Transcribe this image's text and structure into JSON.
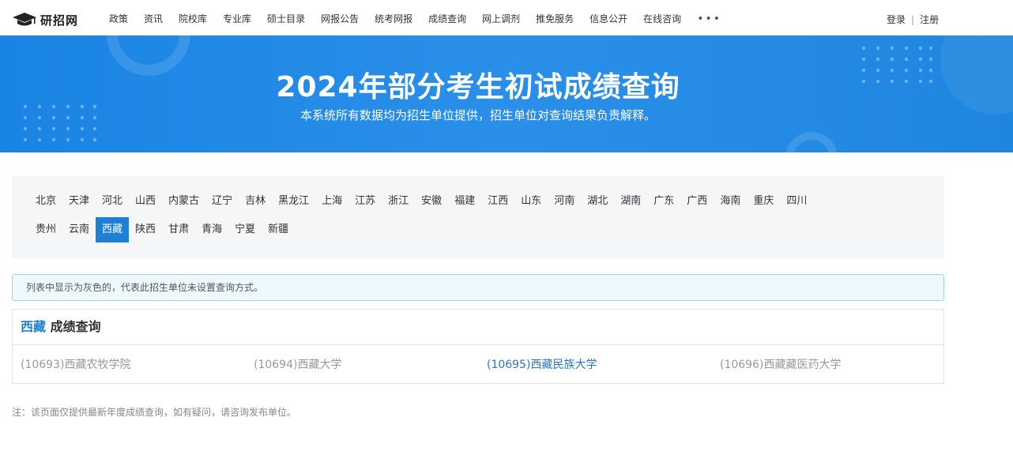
{
  "header": {
    "logo_text": "研招网",
    "nav": [
      "政策",
      "资讯",
      "院校库",
      "专业库",
      "硕士目录",
      "网报公告",
      "统考网报",
      "成绩查询",
      "网上调剂",
      "推免服务",
      "信息公开",
      "在线咨询"
    ],
    "more": "•••",
    "login": "登录",
    "separator": "|",
    "register": "注册"
  },
  "banner": {
    "title": "2024年部分考生初试成绩查询",
    "subtitle": "本系统所有数据均为招生单位提供，招生单位对查询结果负责解释。"
  },
  "provinces": {
    "row1": [
      "北京",
      "天津",
      "河北",
      "山西",
      "内蒙古",
      "辽宁",
      "吉林",
      "黑龙江",
      "上海",
      "江苏",
      "浙江",
      "安徽",
      "福建",
      "江西",
      "山东",
      "河南",
      "湖北",
      "湖南",
      "广东",
      "广西",
      "海南",
      "重庆",
      "四川"
    ],
    "row2": [
      "贵州",
      "云南",
      "西藏",
      "陕西",
      "甘肃",
      "青海",
      "宁夏",
      "新疆"
    ],
    "selected": "西藏"
  },
  "info_text": "列表中显示为灰色的，代表此招生单位未设置查询方式。",
  "result": {
    "region": "西藏",
    "title_suffix": "成绩查询",
    "universities": [
      {
        "label": "(10693)西藏农牧学院",
        "enabled": false
      },
      {
        "label": "(10694)西藏大学",
        "enabled": false
      },
      {
        "label": "(10695)西藏民族大学",
        "enabled": true
      },
      {
        "label": "(10696)西藏藏医药大学",
        "enabled": false
      }
    ]
  },
  "note": "注：该页面仅提供最新年度成绩查询，如有疑问，请咨询发布单位。",
  "colors": {
    "banner": "#1a84e4",
    "active_province": "#1e7fd6",
    "link": "#2a76c4",
    "disabled": "#999999"
  }
}
